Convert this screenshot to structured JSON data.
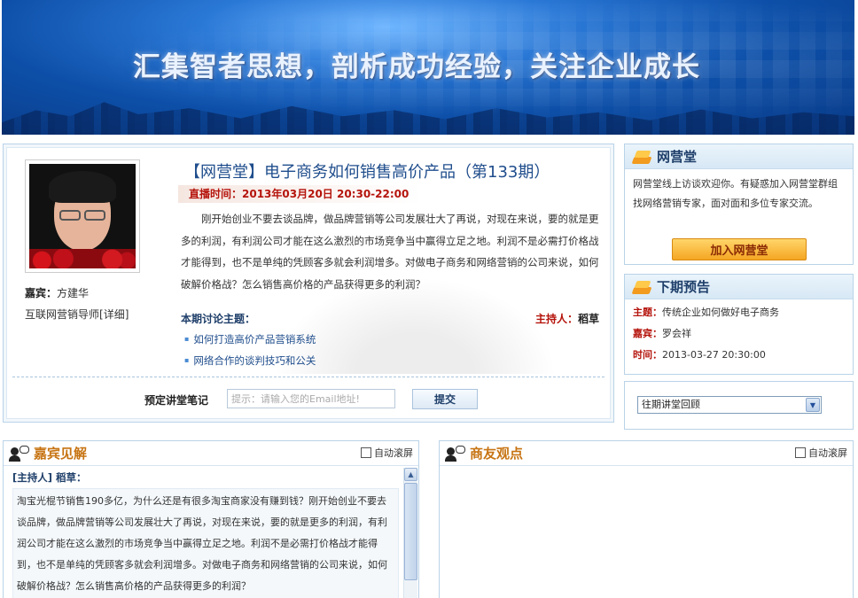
{
  "banner": {
    "slogan": "汇集智者思想，剖析成功经验，关注企业成长"
  },
  "session": {
    "title": "【网营堂】电子商务如何销售高价产品（第133期）",
    "live_time": "直播时间：2013年03月20日 20:30-22:00",
    "description": "刚开始创业不要去谈品牌，做品牌营销等公司发展壮大了再说，对现在来说，要的就是更多的利润，有利润公司才能在这么激烈的市场竞争当中赢得立足之地。利润不是必需打价格战才能得到，也不是单纯的凭顾客多就会利润增多。对做电子商务和网络营销的公司来说，如何破解价格战？怎么销售高价格的产品获得更多的利润？",
    "guest_label": "嘉宾：",
    "guest_name": "方建华",
    "guest_role": "互联网营销导师",
    "guest_detail_link": "[详细]",
    "discuss_heading": "本期讨论主题：",
    "host_label": "主持人：",
    "host_name": "稻草",
    "topics": [
      "如何打造高价产品营销系统",
      "网络合作的谈判技巧和公关"
    ],
    "note_label": "预定讲堂笔记",
    "email_placeholder": "提示：请输入您的Email地址!",
    "submit_label": "提交"
  },
  "sidebar": {
    "intro": {
      "title": "网营堂",
      "text": "网营堂线上访谈欢迎你。有疑惑加入网营堂群组找网络营销专家，面对面和多位专家交流。",
      "join_button": "加入网营堂"
    },
    "next": {
      "title": "下期预告",
      "topic_label": "主题：",
      "topic": "传统企业如何做好电子商务",
      "guest_label": "嘉宾：",
      "guest": "罗会祥",
      "time_label": "时间：",
      "time": "2013-03-27 20:30:00"
    },
    "review": {
      "selected": "往期讲堂回顾"
    }
  },
  "panels": {
    "guest_views": {
      "title": "嘉宾见解",
      "autoscroll": "自动滚屏",
      "author": "[主持人] 稻草：",
      "message": "淘宝光棍节销售190多亿，为什么还是有很多淘宝商家没有赚到钱？刚开始创业不要去谈品牌，做品牌营销等公司发展壮大了再说，对现在来说，要的就是更多的利润，有利润公司才能在这么激烈的市场竞争当中赢得立足之地。利润不是必需打价格战才能得到，也不是单纯的凭顾客多就会利润增多。对做电子商务和网络营销的公司来说，如何破解价格战？怎么销售高价格的产品获得更多的利润？"
    },
    "peer_views": {
      "title": "商友观点",
      "autoscroll": "自动滚屏"
    }
  },
  "colors": {
    "title_blue": "#1f4d8c",
    "accent_red": "#b5140c",
    "panel_orange": "#c77413",
    "border_blue": "#b9d3e8"
  },
  "icons": [
    "up-arrow-icon",
    "chevron-down-icon",
    "stack-icon",
    "chat-person-icon"
  ]
}
